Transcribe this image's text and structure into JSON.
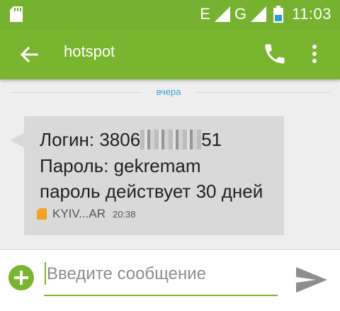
{
  "status_bar": {
    "network_e": "E",
    "network_g": "G",
    "time": "11:03",
    "icons": [
      "sd-card-icon",
      "signal-icon",
      "battery-icon"
    ]
  },
  "app_bar": {
    "title": "hotspot",
    "icons": [
      "back-arrow-icon",
      "phone-icon",
      "more-vert-icon"
    ]
  },
  "conversation": {
    "date_divider": "вчера",
    "message": {
      "line1_prefix": "Логин: 3806",
      "line1_suffix": "51",
      "line2": "Пароль: gekremam",
      "line3": "пароль действует 30 дней",
      "sender": "KYIV...AR",
      "time": "20:38"
    }
  },
  "compose": {
    "placeholder": "Введите сообщение",
    "value": ""
  },
  "colors": {
    "accent": "#7ab52f",
    "status_bar": "#76b22f",
    "bubble": "#d9d9d9",
    "link_blue": "#3aa5d6",
    "sim_orange": "#f3a21f",
    "send_gray": "#8e8e8e"
  }
}
